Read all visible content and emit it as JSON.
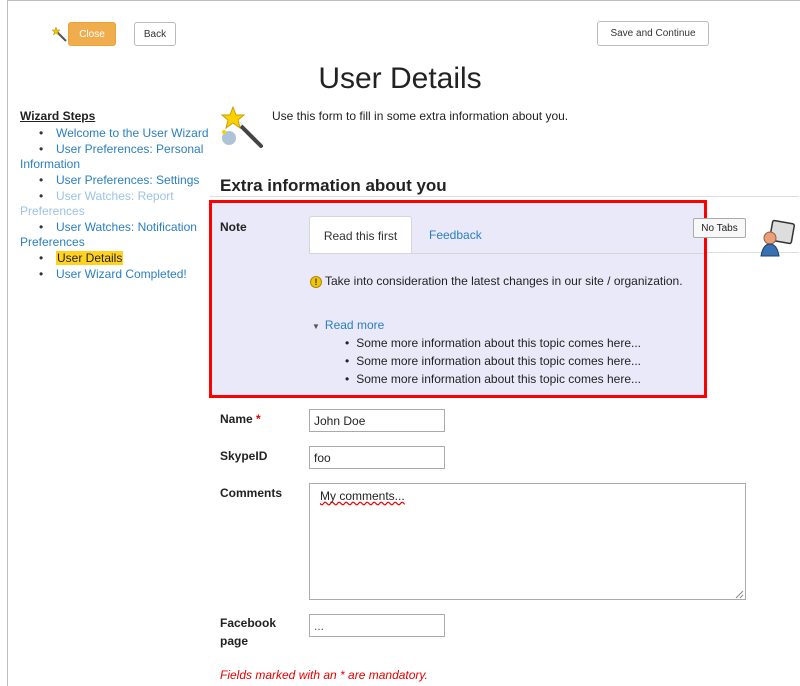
{
  "toolbar": {
    "close_label": "Close",
    "back_label": "Back",
    "save_label": "Save and Continue"
  },
  "page_title": "User Details",
  "wizard": {
    "title": "Wizard Steps",
    "steps": [
      {
        "line1": "Welcome to the User Wizard",
        "line2": "",
        "state": "link"
      },
      {
        "line1": "User Preferences: Personal",
        "line2": "Information",
        "state": "link"
      },
      {
        "line1": "User Preferences: Settings",
        "line2": "",
        "state": "link"
      },
      {
        "line1": "User Watches: Report",
        "line2": "Preferences",
        "state": "muted"
      },
      {
        "line1": "User Watches: Notification",
        "line2": "Preferences",
        "state": "link"
      },
      {
        "line1": "User Details",
        "line2": "",
        "state": "current"
      },
      {
        "line1": "User Wizard Completed!",
        "line2": "",
        "state": "link"
      }
    ]
  },
  "intro_text": "Use this form to fill in some extra information about you.",
  "section_title": "Extra information about you",
  "note": {
    "label": "Note",
    "tabs": [
      {
        "label": "Read this first",
        "active": true
      },
      {
        "label": "Feedback",
        "active": false
      }
    ],
    "no_tabs_label": "No Tabs",
    "warning": "Take into consideration the latest changes in our site / organization.",
    "read_more": "Read more",
    "more_items": [
      "Some more information about this topic comes here...",
      "Some more information about this topic comes here...",
      "Some more information about this topic comes here..."
    ]
  },
  "form": {
    "name_label": "Name",
    "required_mark": "*",
    "name_value": "John Doe",
    "skype_label": "SkypeID",
    "skype_value": "foo",
    "comments_label": "Comments",
    "comments_value": "My comments...",
    "facebook_label_1": "Facebook",
    "facebook_label_2": "page",
    "facebook_placeholder": "..."
  },
  "mandatory_note": "Fields marked with an * are mandatory.",
  "colors": {
    "accent": "#f0ad4e",
    "link": "#2a7fc0",
    "highlight": "#ffd21f",
    "note_bg": "#e9e9f9",
    "note_border": "#ff0000",
    "required": "#e60000"
  },
  "icons": [
    "magic-wand-icon",
    "wizard-wand-icon",
    "warning-icon",
    "user-icon",
    "triangle-down-icon",
    "resize-grip-icon"
  ]
}
